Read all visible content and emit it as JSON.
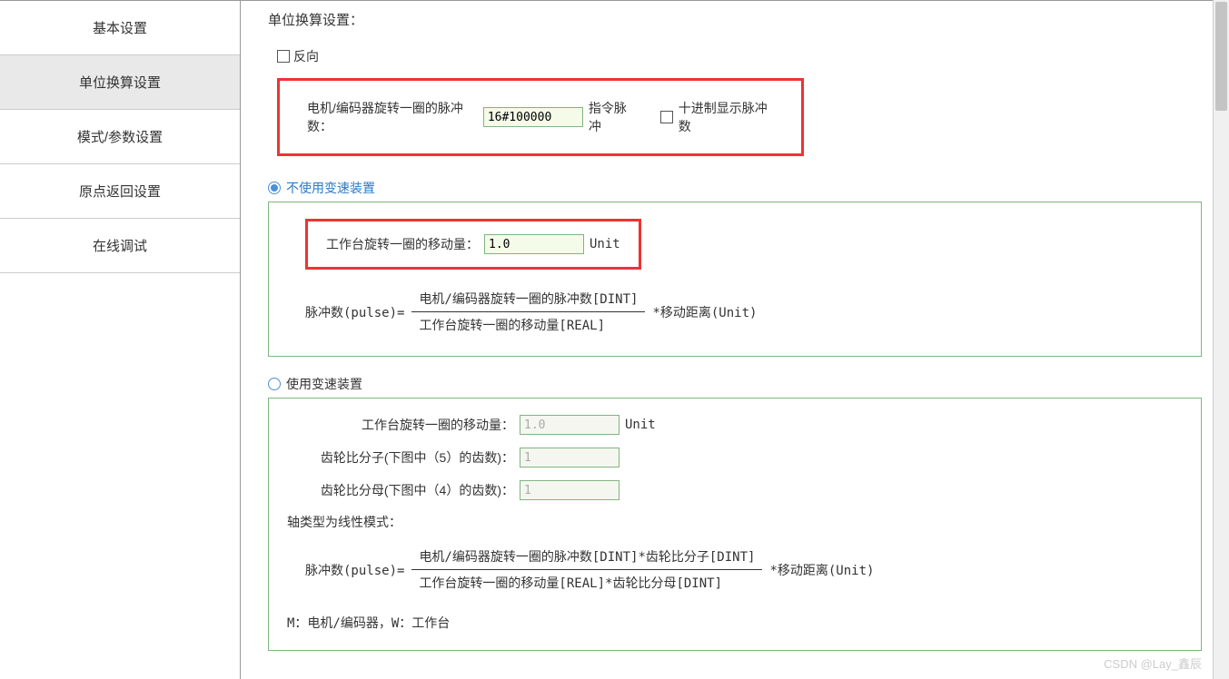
{
  "sidebar": {
    "items": [
      {
        "label": "基本设置"
      },
      {
        "label": "单位换算设置"
      },
      {
        "label": "模式/参数设置"
      },
      {
        "label": "原点返回设置"
      },
      {
        "label": "在线调试"
      }
    ]
  },
  "main": {
    "title": "单位换算设置：",
    "reverse_label": "反向",
    "pulses_per_rev_label": "电机/编码器旋转一圈的脉冲数：",
    "pulses_per_rev_value": "16#100000",
    "pulses_per_rev_unit": "指令脉冲",
    "decimal_display_label": "十进制显示脉冲数",
    "radio_no_gear": "不使用变速装置",
    "radio_use_gear": "使用变速装置",
    "no_gear": {
      "move_per_rev_label": "工作台旋转一圈的移动量：",
      "move_per_rev_value": "1.0",
      "move_per_rev_unit": "Unit",
      "formula_left": "脉冲数(pulse)=",
      "formula_num": "电机/编码器旋转一圈的脉冲数[DINT]",
      "formula_den": "工作台旋转一圈的移动量[REAL]",
      "formula_right": "*移动距离(Unit)"
    },
    "use_gear": {
      "move_per_rev_label": "工作台旋转一圈的移动量：",
      "move_per_rev_value": "1.0",
      "move_per_rev_unit": "Unit",
      "gear_num_label": "齿轮比分子(下图中（5）的齿数)：",
      "gear_num_value": "1",
      "gear_den_label": "齿轮比分母(下图中（4）的齿数)：",
      "gear_den_value": "1",
      "axis_mode_label": "轴类型为线性模式：",
      "formula_left": "脉冲数(pulse)=",
      "formula_num": "电机/编码器旋转一圈的脉冲数[DINT]*齿轮比分子[DINT]",
      "formula_den": "工作台旋转一圈的移动量[REAL]*齿轮比分母[DINT]",
      "formula_right": "*移动距离(Unit)"
    },
    "legend": "M：电机/编码器，W：工作台"
  },
  "watermark": "CSDN @Lay_鑫辰"
}
